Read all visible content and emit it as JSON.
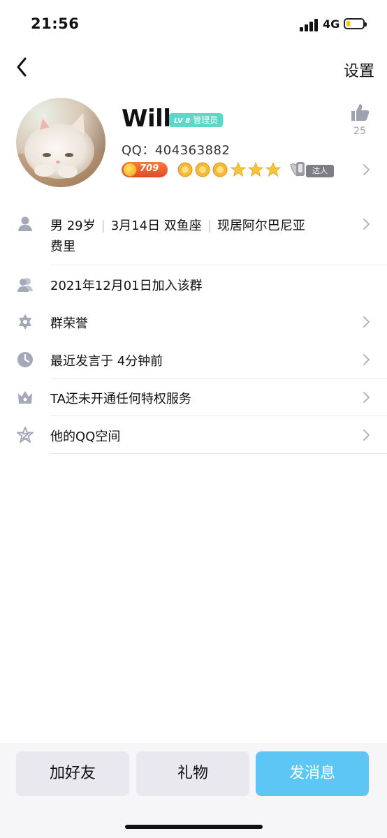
{
  "status_bar": {
    "time": "21:56",
    "network": "4G"
  },
  "nav": {
    "back_icon": "chevron-left-icon",
    "settings_label": "设置"
  },
  "profile": {
    "name": "Will",
    "badge_level": "LV 8",
    "badge_role": "管理员",
    "qq_label": "QQ：",
    "qq_number": "404363882",
    "coin_value": "709",
    "talent_label": "达人",
    "like_count": "25"
  },
  "info": {
    "gender_age": "男 29岁",
    "birthday": "3月14日 双鱼座",
    "location_line1": "现居阿尔巴尼亚",
    "location_line2": "费里"
  },
  "list": {
    "joined": "2021年12月01日加入该群",
    "honor": "群荣誉",
    "last_spoke": "最近发言于 4分钟前",
    "privilege": "TA还未开通任何特权服务",
    "qzone": "他的QQ空间"
  },
  "actions": {
    "add_friend": "加好友",
    "gift": "礼物",
    "send_message": "发消息"
  },
  "colors": {
    "accent": "#5dc6f5",
    "badge": "#5ed7c9",
    "icon_gray": "#9ea2ae"
  }
}
